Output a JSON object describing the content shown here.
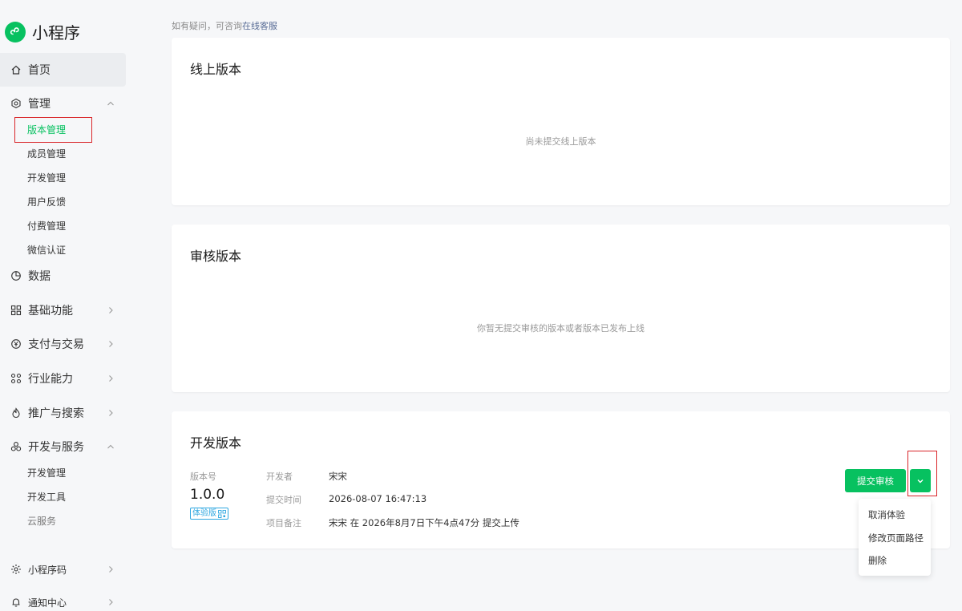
{
  "brand": {
    "title": "小程序"
  },
  "sidebar": {
    "home": "首页",
    "manage": {
      "label": "管理",
      "items": [
        "版本管理",
        "成员管理",
        "开发管理",
        "用户反馈",
        "付费管理",
        "微信认证"
      ]
    },
    "data": "数据",
    "basic": "基础功能",
    "payment": "支付与交易",
    "industry": "行业能力",
    "promotion": "推广与搜索",
    "devservice": {
      "label": "开发与服务",
      "items": [
        "开发管理",
        "开发工具",
        "云服务"
      ]
    },
    "qrcode": "小程序码",
    "notify": "通知中心"
  },
  "hint": {
    "text": "如有疑问，可咨询",
    "link": "在线客服"
  },
  "online": {
    "title": "线上版本",
    "empty": "尚未提交线上版本"
  },
  "review": {
    "title": "审核版本",
    "empty": "你暂无提交审核的版本或者版本已发布上线"
  },
  "dev": {
    "title": "开发版本",
    "version_label": "版本号",
    "version": "1.0.0",
    "tag": "体验版",
    "developer_label": "开发者",
    "developer": "宋宋",
    "time_label": "提交时间",
    "time": "2026-08-07 16:47:13",
    "note_label": "项目备注",
    "note": "宋宋 在 2026年8月7日下午4点47分 提交上传",
    "submit_button": "提交审核",
    "menu": [
      "取消体验",
      "修改页面路径",
      "删除"
    ]
  },
  "colors": {
    "accent": "#07c160",
    "highlight": "#d9262a",
    "link": "#576b95",
    "tag": "#2ea7e0"
  }
}
